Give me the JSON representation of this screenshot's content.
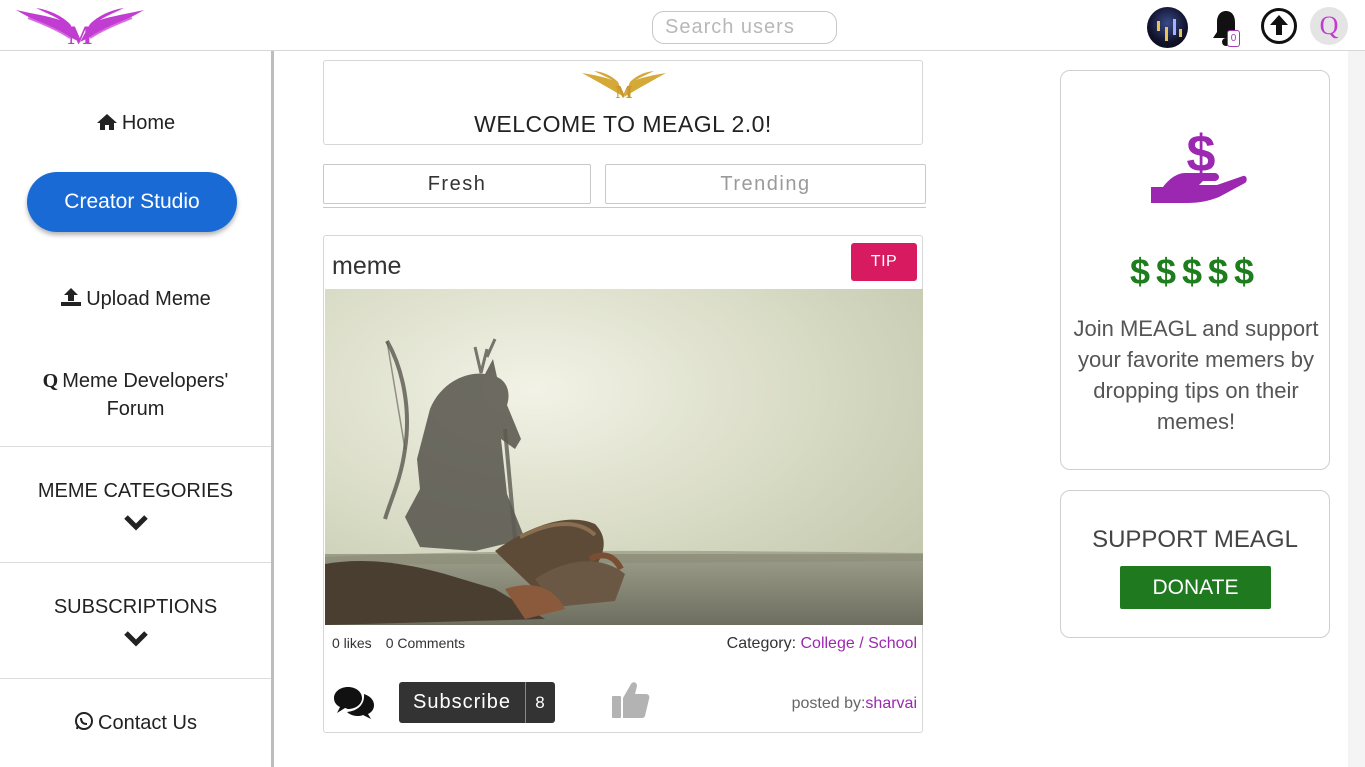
{
  "header": {
    "search_placeholder": "Search users",
    "notification_count": "0",
    "user_initial": "Q"
  },
  "sidebar": {
    "home_label": "Home",
    "creator_studio_label": "Creator Studio",
    "upload_label": "Upload Meme",
    "forum_label_line1": "Meme Developers'",
    "forum_label_line2": "Forum",
    "categories_label": "MEME CATEGORIES",
    "subscriptions_label": "SUBSCRIPTIONS",
    "contact_label": "Contact Us"
  },
  "welcome": {
    "title": "WELCOME TO MEAGL 2.0!"
  },
  "tabs": {
    "fresh": "Fresh",
    "trending": "Trending"
  },
  "post": {
    "title": "meme",
    "tip_label": "TIP",
    "likes": "0 likes",
    "comments": "0 Comments",
    "category_label": "Category:",
    "category_value": "College / School",
    "subscribe_label": "Subscribe",
    "subscriber_count": "8",
    "posted_by_label": "posted by:",
    "posted_by_user": "sharvai"
  },
  "tips_card": {
    "dollars": "$$$$$",
    "text": "Join MEAGL and support your favorite memers by dropping tips on their memes!"
  },
  "support_card": {
    "title": "SUPPORT MEAGL",
    "donate_label": "DONATE"
  },
  "colors": {
    "brand_purple": "#c13cd0",
    "creator_blue": "#1a6ad6",
    "tip_pink": "#d81b60",
    "donate_green": "#1f7a1f"
  },
  "icons": [
    "meagl-logo",
    "bell-icon",
    "upload-icon",
    "home-icon",
    "upload-meme-icon",
    "quora-icon",
    "chevron-down-icon",
    "whatsapp-icon",
    "comments-icon",
    "thumbs-up-icon",
    "hand-dollar-icon"
  ]
}
